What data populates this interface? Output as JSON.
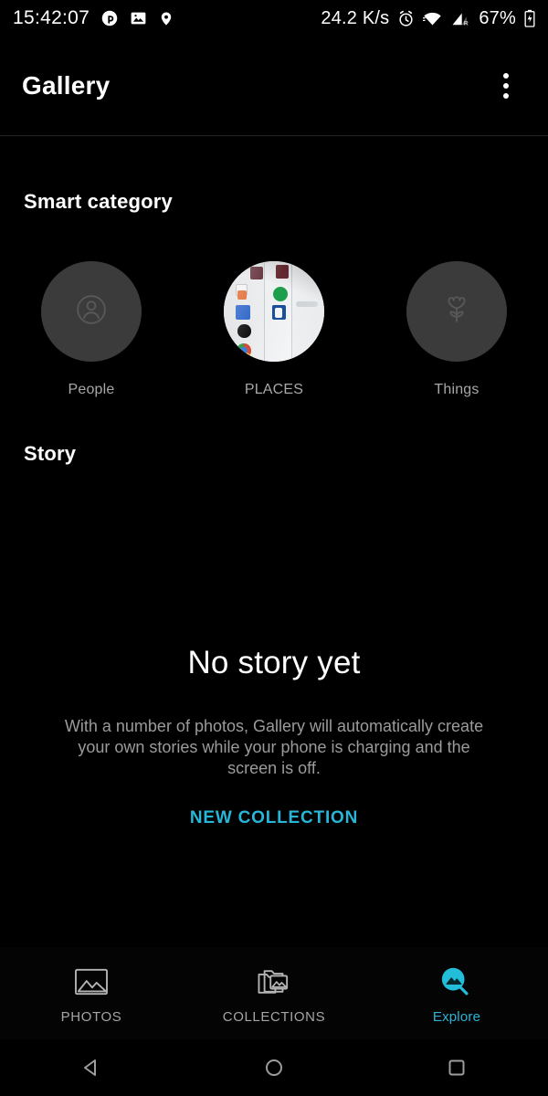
{
  "statusbar": {
    "clock": "15:42:07",
    "left_icons": [
      "pinterest-p-icon",
      "photo-icon",
      "location-pin-icon"
    ],
    "network_speed": "24.2 K/s",
    "right_icons": [
      "alarm-clock-icon",
      "wifi-icon",
      "cellular-signal-roaming-icon"
    ],
    "battery_percent": "67%",
    "battery_icon": "battery-charging-icon"
  },
  "appbar": {
    "title": "Gallery",
    "overflow_icon": "overflow-menu-icon"
  },
  "smart_category": {
    "heading": "Smart category",
    "items": [
      {
        "label": "People",
        "icon": "person-icon",
        "kind": "icon"
      },
      {
        "label": "PLACES",
        "icon": "places-photo-thumbnail",
        "kind": "photo"
      },
      {
        "label": "Things",
        "icon": "flower-icon",
        "kind": "icon"
      }
    ]
  },
  "story": {
    "heading": "Story",
    "empty_title": "No story yet",
    "empty_description": "With a number of photos, Gallery will automatically create your own stories while your phone is charging and the screen is off.",
    "cta_label": "NEW COLLECTION"
  },
  "bottom_nav": {
    "items": [
      {
        "label": "PHOTOS",
        "icon": "photos-image-icon",
        "active": false
      },
      {
        "label": "COLLECTIONS",
        "icon": "collections-folder-icon",
        "active": false
      },
      {
        "label": "Explore",
        "icon": "explore-search-icon",
        "active": true
      }
    ]
  },
  "android_nav": {
    "back": "back-triangle-icon",
    "home": "home-circle-icon",
    "recents": "recents-square-icon"
  },
  "colors": {
    "background": "#000000",
    "accent": "#27b6d7",
    "circle_fill": "#3b3b3b",
    "secondary_text": "#9b9b9b",
    "divider": "#222326"
  }
}
